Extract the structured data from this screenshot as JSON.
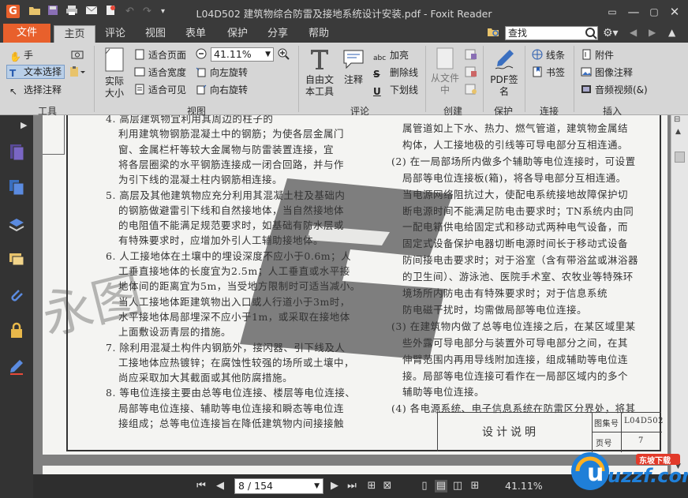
{
  "window": {
    "title": "L04D502 建筑物综合防雷及接地系统设计安装.pdf - Foxit Reader"
  },
  "menu": {
    "file": "文件",
    "tabs": [
      "主页",
      "评论",
      "视图",
      "表单",
      "保护",
      "分享",
      "帮助"
    ]
  },
  "search": {
    "value": "查找"
  },
  "ribbon": {
    "tools": {
      "hand": "手",
      "select_text": "文本选择",
      "select_annot": "选择注释",
      "group": "工具"
    },
    "view": {
      "actual_size": "实际大小",
      "fit_page": "适合页面",
      "fit_width": "适合宽度",
      "fit_visible": "适合可见",
      "zoom_value": "41.11%",
      "rotate_left": "向左旋转",
      "rotate_right": "向右旋转",
      "group": "视图"
    },
    "comment": {
      "free_text": "自由文本工具",
      "note": "注释",
      "highlight": "加亮",
      "strikeout": "删除线",
      "underline": "下划线",
      "group": "评论"
    },
    "create": {
      "from_file": "从文件中",
      "group": "创建"
    },
    "protect": {
      "sign": "PDF签名",
      "group": "保护"
    },
    "link": {
      "link": "线条",
      "bookmark": "书签",
      "group": "连接"
    },
    "insert": {
      "attachment": "附件",
      "image_annot": "图像注释",
      "audio_video": "音频视频(&)",
      "group": "插入"
    }
  },
  "document": {
    "left_lines": [
      "4. 高层建筑物宜利用其周边的柱子的",
      "利用建筑物钢筋混凝土中的钢筋；为使各层金属门",
      "窗、金属栏杆等较大金属物与防雷装置连接，宜",
      "将各层圈梁的水平钢筋连接成一闭合回路，并与作",
      "为引下线的混凝土柱内钢筋相连接。",
      "5. 高层及其他建筑物应充分利用其混凝土柱及基础内",
      "的钢筋做避雷引下线和自然接地体，当自然接地体",
      "的电阻值不能满足规范要求时，如基础有防水层或",
      "有特殊要求时，应增加外引人工辅助接地体。",
      "6. 人工接地体在土壤中的埋设深度不应小于0.6m；人",
      "工垂直接地体的长度宜为2.5m；人工垂直或水平接",
      "地体间的距离宜为5m，当受地方限制时可适当减小。",
      "当人工接地体距建筑物出入口或人行道小于3m时，",
      "水平接地体局部埋深不应小于1m，或采取在接地体",
      "上面敷设沥青层的措施。",
      "7. 除利用混凝土构件内钢筋外，接闪器、引下线及人",
      "工接地体应热镀锌；在腐蚀性较强的场所或土壤中，",
      "尚应采取加大其截面或其他防腐措施。",
      "8. 等电位连接主要由总等电位连接、楼层等电位连接、",
      "局部等电位连接、辅助等电位连接和瞬态等电位连",
      "接组成；总等电位连接旨在降低建筑物内间接接触"
    ],
    "right_lines": [
      "属管道如上下水、热力、燃气管道，建筑物金属结",
      "构体，人工接地极的引线等可导电部分互相连通。",
      "(2) 在一局部场所内做多个辅助等电位连接时，可设置",
      "局部等电位连接板(箱)，将各导电部分互相连通。",
      "当电源网络阻抗过大，使配电系统接地故障保护切",
      "断电源时间不能满足防电击要求时；TN系统内由同",
      "一配电箱供电给固定式和移动式两种电气设备，而",
      "固定式设备保护电器切断电源时间长于移动式设备",
      "防间接电击要求时；对于浴室（含有带浴盆或淋浴器",
      "的卫生间）、游泳池、医院手术室、农牧业等特殊环",
      "境场所内防电击有特殊要求时；对于信息系统",
      "防电磁干扰时，均需做局部等电位连接。",
      "(3) 在建筑物内做了总等电位连接之后，在某区域里某",
      "些外露可导电部分与装置外可导电部分之间，在其",
      "伸臂范围内再用导线附加连接，组成辅助等电位连",
      "接。局部等电位连接可看作在一局部区域内的多个",
      "辅助等电位连接。",
      "(4) 各电源系统、电子信息系统在防雷区分界处，将其"
    ],
    "stamp": {
      "design_note": "设计说明",
      "atlas_no_label": "图集号",
      "atlas_no": "L04D502",
      "page_label": "页号",
      "page_no": "7"
    },
    "watermark_text": "永图"
  },
  "statusbar": {
    "page": "8 / 154",
    "zoom": "41.11%"
  },
  "brand": {
    "logo": "uzzf.com",
    "sub": "东坡下载"
  }
}
